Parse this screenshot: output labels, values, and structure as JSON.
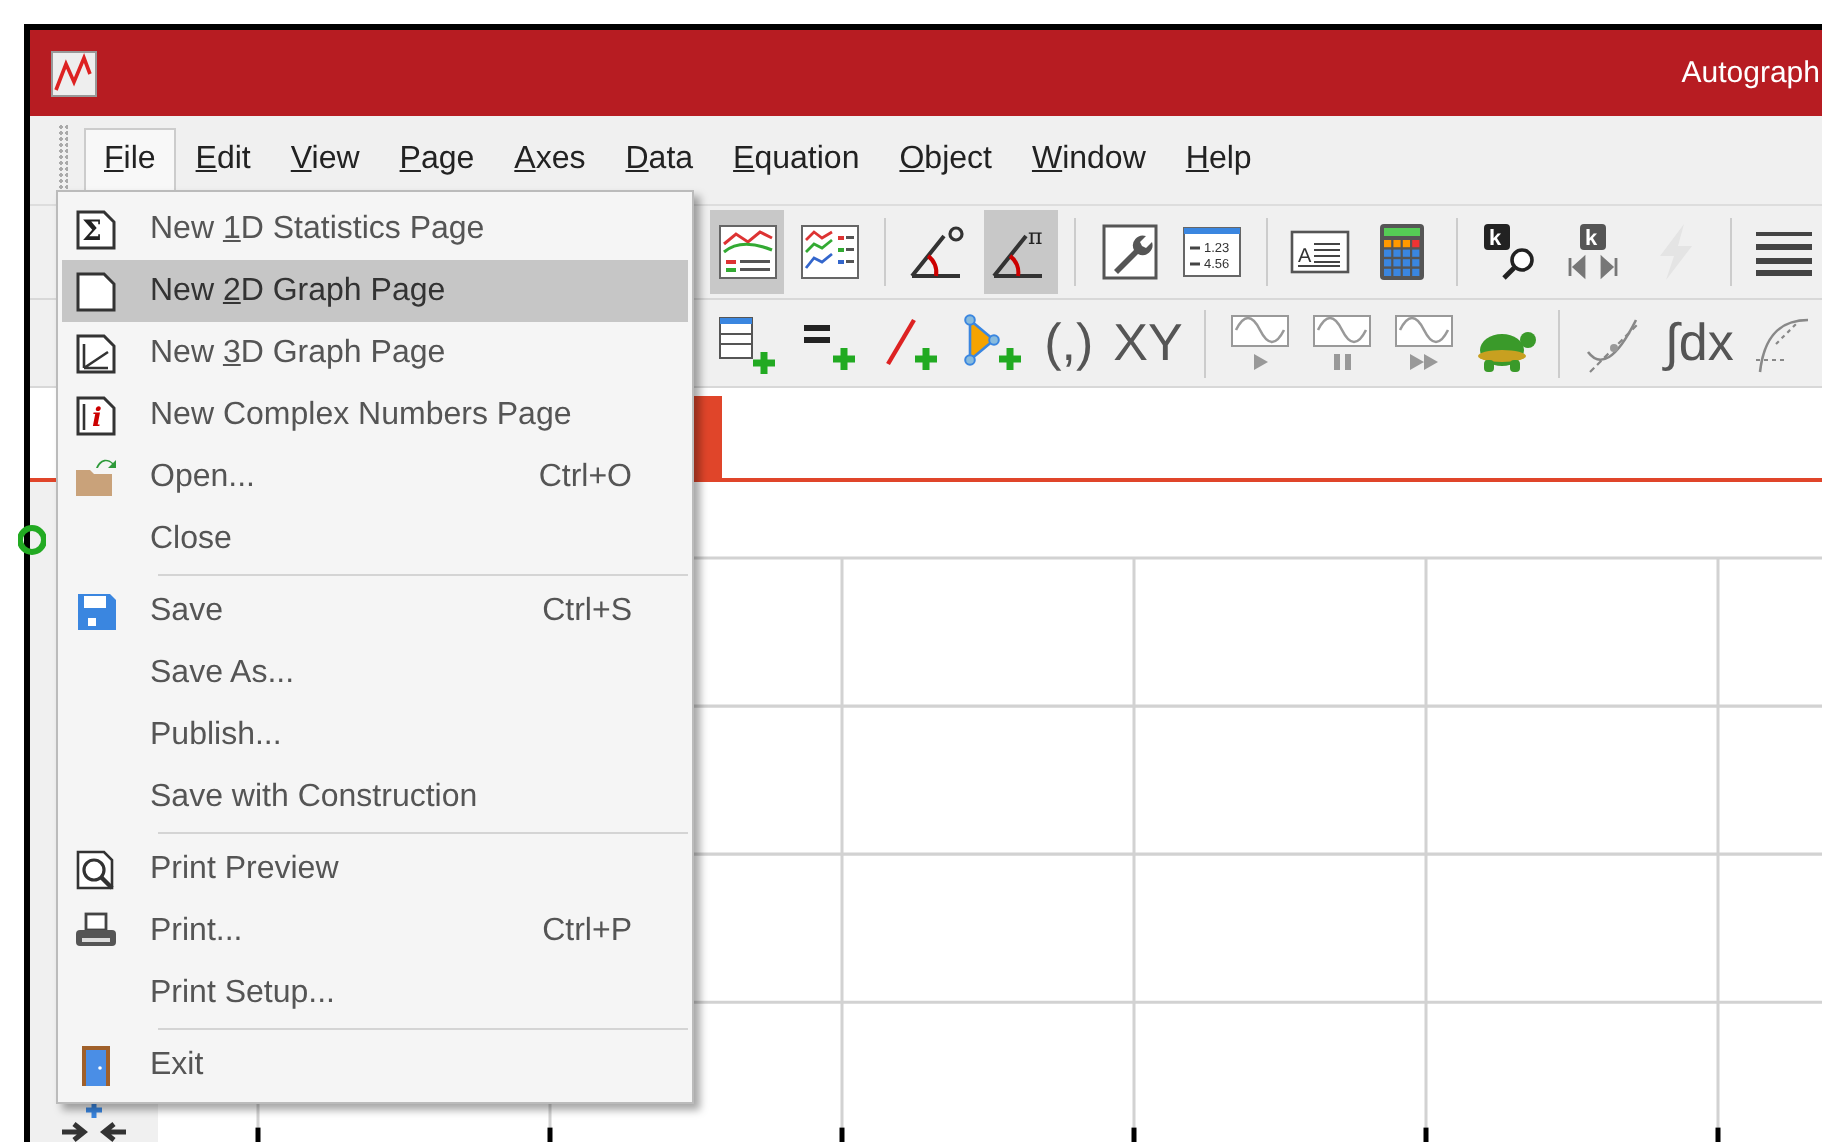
{
  "window": {
    "title": "Autograph"
  },
  "menu_bar": [
    {
      "key": "F",
      "after": "ile",
      "selected": true
    },
    {
      "key": "E",
      "after": "dit",
      "selected": false
    },
    {
      "key": "V",
      "after": "iew",
      "selected": false
    },
    {
      "key": "P",
      "after": "age",
      "selected": false
    },
    {
      "key": "A",
      "after": "xes",
      "selected": false
    },
    {
      "key": "D",
      "after": "ata",
      "selected": false
    },
    {
      "key": "E",
      "after": "quation",
      "selected": false
    },
    {
      "key": "O",
      "after": "bject",
      "selected": false
    },
    {
      "key": "W",
      "after": "indow",
      "selected": false
    },
    {
      "key": "H",
      "after": "elp",
      "selected": false
    }
  ],
  "toolbar_1": [
    {
      "kind": "chart-lines",
      "pressed": true
    },
    {
      "kind": "chart-legend",
      "pressed": false
    },
    {
      "kind": "separator"
    },
    {
      "kind": "angle-degree",
      "pressed": false
    },
    {
      "kind": "angle-radian",
      "pressed": true,
      "glyphs": [
        "π"
      ]
    },
    {
      "kind": "separator"
    },
    {
      "kind": "wrench",
      "pressed": false
    },
    {
      "kind": "table",
      "pressed": false,
      "glyphs": [
        "1.23",
        "4.56"
      ]
    },
    {
      "kind": "separator"
    },
    {
      "kind": "text-box",
      "pressed": false,
      "glyphs": [
        "A"
      ]
    },
    {
      "kind": "calculator",
      "pressed": false
    },
    {
      "kind": "separator"
    },
    {
      "kind": "k-search",
      "pressed": false,
      "glyphs": [
        "k"
      ]
    },
    {
      "kind": "k-player",
      "pressed": false,
      "glyphs": [
        "k"
      ]
    },
    {
      "kind": "lightning",
      "pressed": false,
      "disabled": true
    },
    {
      "kind": "separator"
    },
    {
      "kind": "lines",
      "pressed": false
    }
  ],
  "toolbar_2": [
    {
      "kind": "table-plus"
    },
    {
      "kind": "equals-plus"
    },
    {
      "kind": "line-plus"
    },
    {
      "kind": "triangle-plus"
    },
    {
      "kind": "text",
      "text": "(,)"
    },
    {
      "kind": "text",
      "text": "XY"
    },
    {
      "kind": "separator"
    },
    {
      "kind": "wave-play"
    },
    {
      "kind": "wave-pause"
    },
    {
      "kind": "wave-forward"
    },
    {
      "kind": "turtle"
    },
    {
      "kind": "separator"
    },
    {
      "kind": "curve-tangent"
    },
    {
      "kind": "text",
      "text": "∫dx"
    },
    {
      "kind": "curve-dotted"
    }
  ],
  "file_menu": [
    {
      "kind": "sigma-page",
      "glyph": "Σ",
      "before": "New ",
      "key": "1",
      "after": "D Statistics Page",
      "selected": false
    },
    {
      "kind": "blank-page",
      "before": "New ",
      "key": "2",
      "after": "D Graph Page",
      "selected": true
    },
    {
      "kind": "axes",
      "before": "New ",
      "key": "3",
      "after": "D Graph Page",
      "selected": false
    },
    {
      "kind": "complex-page",
      "glyph": "i",
      "after": "New Complex Numbers Page",
      "selected": false
    },
    {
      "kind": "folder",
      "after": "Open...",
      "shortcut": "Ctrl+O",
      "selected": false
    },
    {
      "kind": "item",
      "after": "Close",
      "selected": false
    },
    {
      "kind": "separator"
    },
    {
      "kind": "floppy",
      "after": "Save",
      "shortcut": "Ctrl+S",
      "selected": false
    },
    {
      "kind": "item",
      "after": "Save As...",
      "selected": false
    },
    {
      "kind": "item",
      "after": "Publish...",
      "selected": false
    },
    {
      "kind": "item",
      "after": "Save with Construction",
      "selected": false
    },
    {
      "kind": "separator"
    },
    {
      "kind": "preview",
      "after": "Print Preview",
      "selected": false
    },
    {
      "kind": "printer",
      "after": "Print...",
      "shortcut": "Ctrl+P",
      "selected": false
    },
    {
      "kind": "item",
      "after": "Print Setup...",
      "selected": false
    },
    {
      "kind": "separator"
    },
    {
      "kind": "door",
      "after": "Exit",
      "selected": false
    }
  ]
}
